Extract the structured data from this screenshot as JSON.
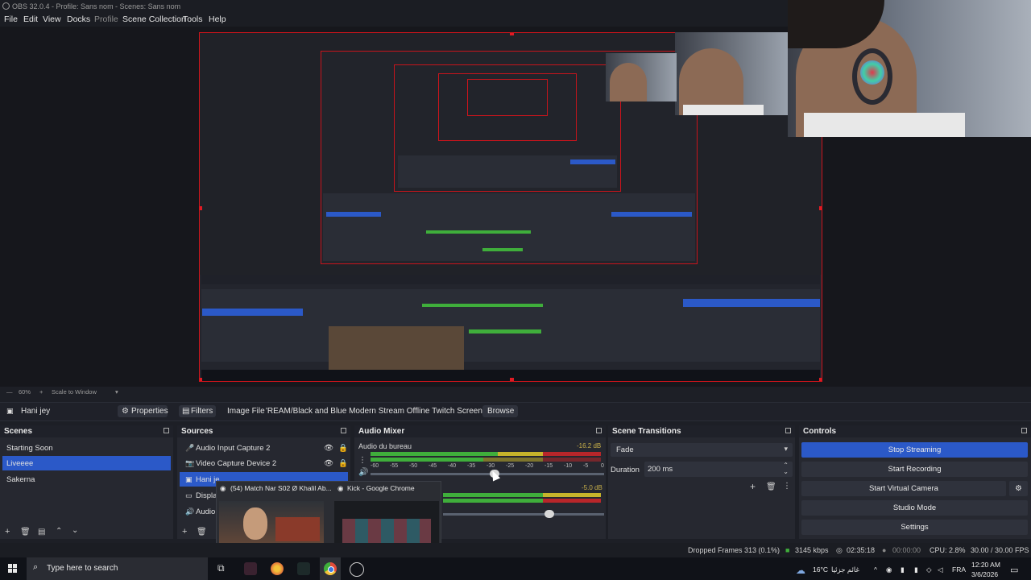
{
  "window": {
    "title": "OBS 32.0.4 - Profile: Sans nom - Scenes: Sans nom"
  },
  "menu": {
    "items": [
      "File",
      "Edit",
      "View",
      "Docks",
      "Profile",
      "Scene Collection",
      "Tools",
      "Help"
    ]
  },
  "preview": {
    "zoom": "60%",
    "scale_mode": "Scale to Window"
  },
  "propbar": {
    "source_name": "Hani jey",
    "properties": "Properties",
    "filters": "Filters",
    "image_file_label": "Image File",
    "image_path": "'REAM/Black and Blue Modern Stream Offline Twitch Screen.png",
    "browse": "Browse"
  },
  "scenes": {
    "title": "Scenes",
    "items": [
      "Starting Soon",
      "Liveeee",
      "Sakerna"
    ],
    "selected": "Liveeee"
  },
  "sources": {
    "title": "Sources",
    "items": [
      "Audio Input Capture 2",
      "Video Capture Device 2",
      "Hani je",
      "Displa",
      "Audio"
    ]
  },
  "mixer": {
    "title": "Audio Mixer",
    "channels": [
      {
        "name": "Audio du bureau",
        "level": "-16.2 dB"
      },
      {
        "name": "",
        "level": "-5.0 dB"
      }
    ],
    "ticks": [
      "-60",
      "-55",
      "-50",
      "-45",
      "-40",
      "-35",
      "-30",
      "-25",
      "-20",
      "-15",
      "-10",
      "-5",
      "0"
    ]
  },
  "transitions": {
    "title": "Scene Transitions",
    "selected": "Fade",
    "duration_label": "Duration",
    "duration_value": "200 ms"
  },
  "controls": {
    "title": "Controls",
    "buttons": [
      "Stop Streaming",
      "Start Recording",
      "Start Virtual Camera",
      "Studio Mode",
      "Settings"
    ]
  },
  "status": {
    "dropped": "Dropped Frames 313 (0.1%)",
    "bitrate": "3145 kbps",
    "stream_time": "02:35:18",
    "rec_time": "00:00:00",
    "cpu": "CPU: 2.8%",
    "fps": "30.00 / 30.00 FPS"
  },
  "taskbar_popup": {
    "items": [
      "(54) Match Nar S02 Ø Khalil Ab...",
      "Kick - Google Chrome"
    ]
  },
  "taskbar": {
    "search_placeholder": "Type here to search",
    "weather": "16°C",
    "weather_desc": "غائم جزئيا",
    "lang": "FRA",
    "time": "12:20 AM",
    "date": "3/6/2026"
  },
  "colors": {
    "accent": "#2b59c8",
    "canvas_border": "#d0141b",
    "meter_green": "#3fae3b",
    "meter_yellow": "#c7b42b",
    "meter_red": "#b8262a"
  },
  "icons": [
    "obs-icon",
    "eye-icon",
    "lock-icon",
    "gear-icon",
    "windows-icon",
    "search-icon",
    "chrome-icon",
    "speaker-icon",
    "plus-icon",
    "trash-icon"
  ]
}
